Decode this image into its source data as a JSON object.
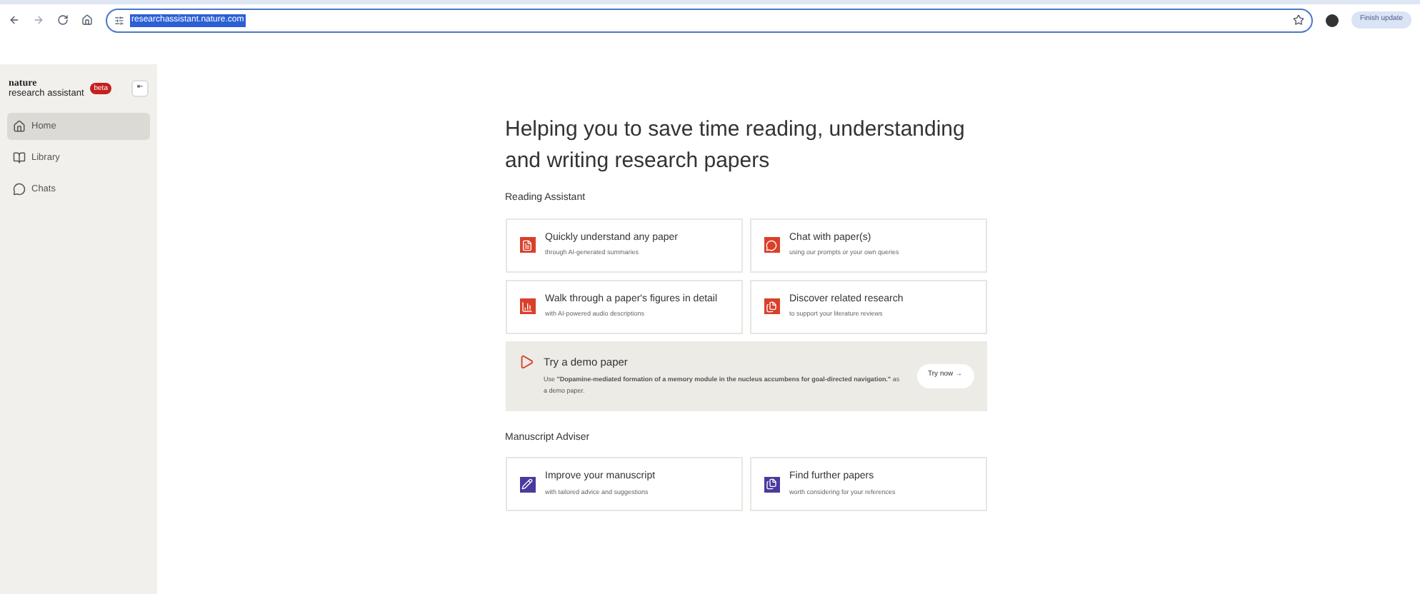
{
  "browser": {
    "url": "researchassistant.nature.com",
    "update_button": "Finish update"
  },
  "sidebar": {
    "logo_top": "nature",
    "logo_bottom": "research assistant",
    "badge": "beta",
    "collapse": "⇤",
    "items": [
      {
        "label": "Home",
        "kind": "home",
        "selected": true
      },
      {
        "label": "Library",
        "kind": "library",
        "selected": false
      },
      {
        "label": "Chats",
        "kind": "chat",
        "selected": false
      }
    ]
  },
  "headline": "Helping you to save time reading, understanding and writing research papers",
  "sections": [
    {
      "title": "Reading Assistant",
      "cards": [
        {
          "title": "Quickly understand any paper",
          "subtitle": "through AI-generated summaries",
          "kind": "doc",
          "color": "#d9402b"
        },
        {
          "title": "Chat with paper(s)",
          "subtitle": "using our prompts or your own queries",
          "kind": "chat",
          "color": "#d9402b"
        },
        {
          "title": "Walk through a paper's figures in detail",
          "subtitle": "with AI-powered audio descriptions",
          "kind": "chart",
          "color": "#d9402b"
        },
        {
          "title": "Discover related research",
          "subtitle": "to support your literature reviews",
          "kind": "files",
          "color": "#d9402b"
        }
      ],
      "demo": {
        "title": "Try a demo paper",
        "text": "Use **\"Dopamine-mediated formation of a memory module in the nucleus accumbens for goal-directed navigation.\"** as a demo paper.",
        "button": "Try now →"
      }
    },
    {
      "title": "Manuscript Adviser",
      "cards": [
        {
          "title": "Improve your manuscript",
          "subtitle": "with tailored advice and suggestions",
          "kind": "pen",
          "color": "#4b3a9e"
        },
        {
          "title": "Find further papers",
          "subtitle": "worth considering for your references",
          "kind": "files",
          "color": "#4b3a9e"
        }
      ]
    }
  ]
}
